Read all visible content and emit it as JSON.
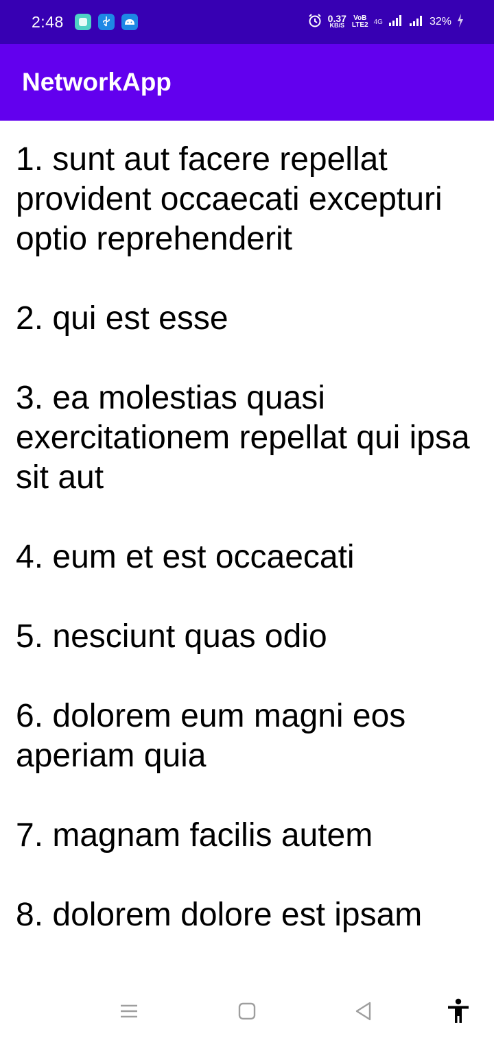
{
  "status_bar": {
    "time": "2:48",
    "speed_value": "0.37",
    "speed_unit": "KB/S",
    "volte_top": "VoB",
    "volte_bottom": "LTE2",
    "network": "4G",
    "battery": "32%",
    "background_color": "#3700b3",
    "icons": [
      "notification-app-icon",
      "usb-icon",
      "android-icon",
      "alarm-icon",
      "signal-icon",
      "signal-icon",
      "charging-icon"
    ]
  },
  "app_bar": {
    "title": "NetworkApp",
    "background_color": "#6200ee"
  },
  "posts": [
    "1. sunt aut facere repellat provident occaecati excepturi optio reprehenderit",
    "2. qui est esse",
    "3. ea molestias quasi exercitationem repellat qui ipsa sit aut",
    "4. eum et est occaecati",
    "5. nesciunt quas odio",
    "6. dolorem eum magni eos aperiam quia",
    "7. magnam facilis autem",
    "8. dolorem dolore est ipsam"
  ],
  "nav_bar": {
    "icons": [
      "menu-icon",
      "home-icon",
      "back-icon",
      "accessibility-icon"
    ]
  }
}
